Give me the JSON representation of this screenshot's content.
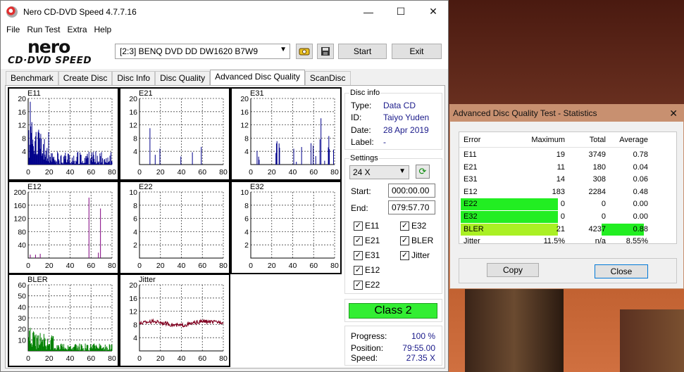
{
  "window": {
    "title": "Nero CD-DVD Speed 4.7.7.16"
  },
  "menu": [
    "File",
    "Run Test",
    "Extra",
    "Help"
  ],
  "logo": {
    "line1": "nero",
    "line2": "CD·DVD SPEED"
  },
  "toolbar": {
    "drive": "[2:3]   BENQ DVD DD DW1620 B7W9",
    "start_label": "Start",
    "exit_label": "Exit"
  },
  "tabs": [
    "Benchmark",
    "Create Disc",
    "Disc Info",
    "Disc Quality",
    "Advanced Disc Quality",
    "ScanDisc"
  ],
  "active_tab": "Advanced Disc Quality",
  "disc_info": {
    "title": "Disc info",
    "type_label": "Type:",
    "type_value": "Data CD",
    "id_label": "ID:",
    "id_value": "Taiyo Yuden",
    "date_label": "Date:",
    "date_value": "28 Apr 2019",
    "label_label": "Label:",
    "label_value": "-"
  },
  "settings": {
    "title": "Settings",
    "speed": "24 X",
    "start_label": "Start:",
    "start_value": "000:00.00",
    "end_label": "End:",
    "end_value": "079:57.70",
    "checks": [
      {
        "label": "E11",
        "checked": true
      },
      {
        "label": "E32",
        "checked": true
      },
      {
        "label": "E21",
        "checked": true
      },
      {
        "label": "BLER",
        "checked": true
      },
      {
        "label": "E31",
        "checked": true
      },
      {
        "label": "Jitter",
        "checked": true
      },
      {
        "label": "E12",
        "checked": true
      },
      {
        "label": "E22",
        "checked": true
      }
    ]
  },
  "class_badge": "Class 2",
  "progress": {
    "progress_label": "Progress:",
    "progress_value": "100 %",
    "position_label": "Position:",
    "position_value": "79:55.00",
    "speed_label": "Speed:",
    "speed_value": "27.35 X"
  },
  "chart_data": [
    {
      "type": "bar",
      "title": "E11",
      "xlim": [
        0,
        80
      ],
      "ylim": [
        0,
        20
      ],
      "yticks": [
        4,
        8,
        12,
        16,
        20
      ],
      "xticks": [
        0,
        20,
        40,
        60,
        80
      ],
      "color": "#00008b"
    },
    {
      "type": "bar",
      "title": "E21",
      "xlim": [
        0,
        80
      ],
      "ylim": [
        0,
        20
      ],
      "yticks": [
        4,
        8,
        12,
        16,
        20
      ],
      "xticks": [
        0,
        20,
        40,
        60,
        80
      ],
      "color": "#00008b"
    },
    {
      "type": "bar",
      "title": "E31",
      "xlim": [
        0,
        80
      ],
      "ylim": [
        0,
        20
      ],
      "yticks": [
        4,
        8,
        12,
        16,
        20
      ],
      "xticks": [
        0,
        20,
        40,
        60,
        80
      ],
      "color": "#00008b"
    },
    {
      "type": "bar",
      "title": "E12",
      "xlim": [
        0,
        80
      ],
      "ylim": [
        0,
        200
      ],
      "yticks": [
        40,
        80,
        120,
        160,
        200
      ],
      "xticks": [
        0,
        20,
        40,
        60,
        80
      ],
      "color": "#800080"
    },
    {
      "type": "bar",
      "title": "E22",
      "xlim": [
        0,
        80
      ],
      "ylim": [
        0,
        10
      ],
      "yticks": [
        2,
        4,
        6,
        8,
        10
      ],
      "xticks": [
        0,
        20,
        40,
        60,
        80
      ],
      "color": "#00008b"
    },
    {
      "type": "bar",
      "title": "E32",
      "xlim": [
        0,
        80
      ],
      "ylim": [
        0,
        10
      ],
      "yticks": [
        2,
        4,
        6,
        8,
        10
      ],
      "xticks": [
        0,
        20,
        40,
        60,
        80
      ],
      "color": "#00008b"
    },
    {
      "type": "bar",
      "title": "BLER",
      "xlim": [
        0,
        80
      ],
      "ylim": [
        0,
        60
      ],
      "yticks": [
        10,
        20,
        30,
        40,
        50,
        60
      ],
      "xticks": [
        0,
        20,
        40,
        60,
        80
      ],
      "color": "#008000"
    },
    {
      "type": "line",
      "title": "Jitter",
      "xlim": [
        0,
        80
      ],
      "ylim": [
        0,
        20
      ],
      "yticks": [
        4,
        8,
        12,
        16,
        20
      ],
      "xticks": [
        0,
        20,
        40,
        60,
        80
      ],
      "color": "#800020"
    }
  ],
  "stats": {
    "title": "Advanced Disc Quality Test - Statistics",
    "headers": [
      "Error",
      "Maximum",
      "Total",
      "Average"
    ],
    "rows": [
      [
        "E11",
        "19",
        "3749",
        "0.78"
      ],
      [
        "E21",
        "11",
        "180",
        "0.04"
      ],
      [
        "E31",
        "14",
        "308",
        "0.06"
      ],
      [
        "E12",
        "183",
        "2284",
        "0.48"
      ],
      [
        "E22",
        "0",
        "0",
        "0.00"
      ],
      [
        "E32",
        "0",
        "0",
        "0.00"
      ],
      [
        "BLER",
        "21",
        "4237",
        "0.88"
      ],
      [
        "Jitter",
        "11.5%",
        "n/a",
        "8.55%"
      ]
    ],
    "copy_label": "Copy",
    "close_label": "Close"
  }
}
